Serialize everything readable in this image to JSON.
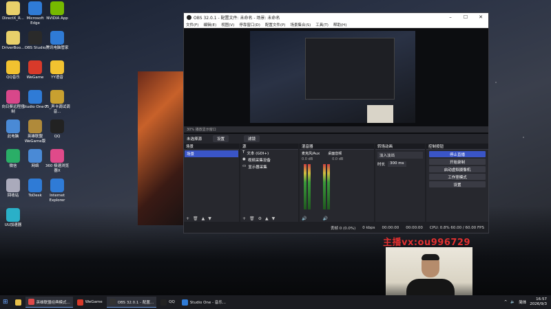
{
  "desktop_icons": [
    {
      "label": "DirectX_R...",
      "color": "#e8d06a"
    },
    {
      "label": "Microsoft Edge",
      "color": "#2f7bd6"
    },
    {
      "label": "NVIDIA App",
      "color": "#76b900"
    },
    {
      "label": "DriverBoo...",
      "color": "#e8d06a"
    },
    {
      "label": "OBS Studio",
      "color": "#2a2a2a"
    },
    {
      "label": "腾讯电脑管家",
      "color": "#2f7bd6"
    },
    {
      "label": "QQ音乐",
      "color": "#f2c230"
    },
    {
      "label": "WeGame",
      "color": "#d83a2a"
    },
    {
      "label": "YY语音",
      "color": "#f2c230"
    },
    {
      "label": "向日葵远程控制",
      "color": "#d8478a"
    },
    {
      "label": "Studio One 7",
      "color": "#2f7bd6"
    },
    {
      "label": "05_声卡调试调音...",
      "color": "#c8a030"
    },
    {
      "label": "此电脑",
      "color": "#4a8ad6"
    },
    {
      "label": "英雄联盟WeGame版",
      "color": "#b08a3a"
    },
    {
      "label": "QQ",
      "color": "#222"
    },
    {
      "label": "微信",
      "color": "#2aae67"
    },
    {
      "label": "网络",
      "color": "#4a8ad6"
    },
    {
      "label": "360 极速浏览器X",
      "color": "#e04a8a"
    },
    {
      "label": "回收站",
      "color": "#aab"
    },
    {
      "label": "ToDesk",
      "color": "#2f7bd6"
    },
    {
      "label": "Internet Explorer",
      "color": "#2f7bd6"
    },
    {
      "label": "UU加速器",
      "color": "#2ab0c8"
    }
  ],
  "obs": {
    "title": "OBS 32.0.1 - 配置文件: 未命名 - 场景: 未命名",
    "menu": [
      "文件(F)",
      "编辑(E)",
      "视图(V)",
      "停靠窗口(D)",
      "配置文件(P)",
      "场景集合(S)",
      "工具(T)",
      "帮助(H)"
    ],
    "status_strip": "30%    播放显示窗口",
    "source_bar": {
      "label": "未选择源",
      "props": "设置",
      "filters": "滤镜"
    },
    "scenes": {
      "header": "场景",
      "items": [
        "场景"
      ]
    },
    "sources": {
      "header": "源",
      "items": [
        "文本 (GDI+)",
        "视频采集设备",
        "显示器采集"
      ]
    },
    "mixer": {
      "header": "混音器",
      "ch1": "麦克风/Aux",
      "ch2": "桌面音频",
      "db": "0.0 dB"
    },
    "transitions": {
      "header": "转场动画",
      "type": "淡入淡出",
      "duration_label": "时长",
      "duration": "300 ms"
    },
    "controls": {
      "header": "控制按钮",
      "buttons": [
        "停止直播",
        "开始录制",
        "启动虚拟摄像机",
        "工作室模式",
        "设置"
      ]
    },
    "status": {
      "dropped": "丢帧 0 (0.0%)",
      "kbps": "0 kbps",
      "t1": "00:00:00",
      "t2": "00:00:00",
      "cpu": "CPU: 0.8%  60.00 / 60.00 FPS"
    }
  },
  "watermark": "主播vx:ou996729",
  "taskbar": {
    "items": [
      {
        "label": "英雄联盟经典模式...",
        "color": "#e04a4a",
        "open": true
      },
      {
        "label": "WeGame",
        "color": "#d83a2a",
        "open": false
      },
      {
        "label": "OBS 32.0.1 - 配置...",
        "color": "#333",
        "open": true
      },
      {
        "label": "QQ",
        "color": "#222",
        "open": false
      },
      {
        "label": "Studio One - 音乐...",
        "color": "#2f7bd6",
        "open": false
      }
    ],
    "ime": "简体",
    "time": "16:57",
    "date": "2026/9/3"
  }
}
